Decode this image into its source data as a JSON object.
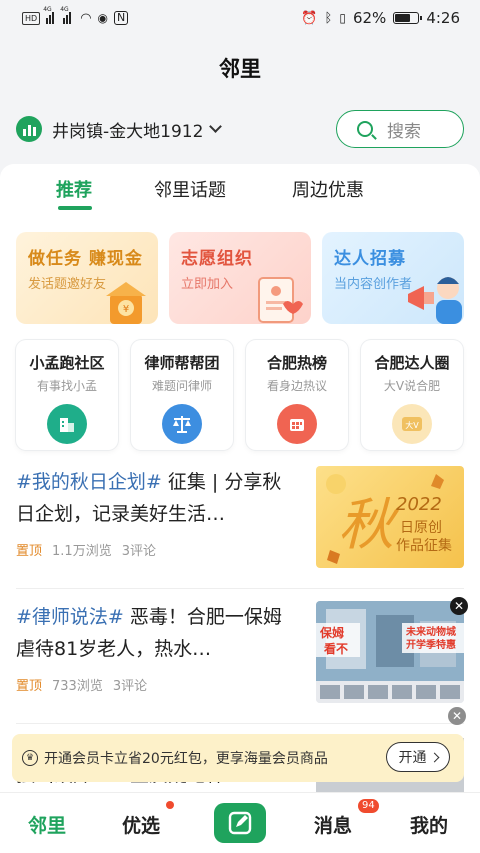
{
  "status_bar": {
    "battery": "62%",
    "time": "4:26",
    "network_left": "4G",
    "network_right": "4G"
  },
  "app_title": "邻里",
  "location": {
    "text": "井岗镇-金大地1912"
  },
  "search": {
    "label": "搜索"
  },
  "tabs": [
    {
      "label": "推荐",
      "active": true
    },
    {
      "label": "邻里话题",
      "active": false
    },
    {
      "label": "周边优惠",
      "active": false
    }
  ],
  "banners": [
    {
      "title": "做任务 赚现金",
      "subtitle": "发话题邀好友"
    },
    {
      "title": "志愿组织",
      "subtitle": "立即加入"
    },
    {
      "title": "达人招募",
      "subtitle": "当内容创作者"
    }
  ],
  "cards": [
    {
      "title": "小孟跑社区",
      "subtitle": "有事找小孟",
      "icon": "building-icon",
      "color": "#1fae8a"
    },
    {
      "title": "律师帮帮团",
      "subtitle": "难题问律师",
      "icon": "scale-icon",
      "color": "#3d8ee0"
    },
    {
      "title": "合肥热榜",
      "subtitle": "看身边热议",
      "icon": "fire-list-icon",
      "color": "#f06452"
    },
    {
      "title": "合肥达人圈",
      "subtitle": "大V说合肥",
      "icon": "bigv-icon",
      "color": "#f0c060"
    }
  ],
  "feed": [
    {
      "tag": "#我的秋日企划#",
      "text": " 征集 | 分享秋日企划，记录美好生活…",
      "pin": "置顶",
      "views": "1.1万浏览",
      "comments": "3评论",
      "thumb_big": "秋",
      "thumb_year": "2022",
      "thumb_line1": "日原创",
      "thumb_line2": "作品征集"
    },
    {
      "tag": "#律师说法#",
      "text": " 恶毒！合肥一保姆虐待81岁老人，热水…",
      "pin": "置顶",
      "views": "733浏览",
      "comments": "3评论",
      "thumb_caption_1": "保姆",
      "thumb_caption_2": "看不",
      "thumb_caption_3": "未来动物城",
      "thumb_caption_4": "开学季特惠"
    }
  ],
  "promo": {
    "text": "开通会员卡立省20元红包，更享海量会员商品",
    "button": "开通",
    "icon_glyph": "♛"
  },
  "partial_feed_text": "独出故障！业主质疑电梯",
  "bottom_nav": [
    {
      "label": "邻里",
      "active": true
    },
    {
      "label": "优选",
      "dot": true
    },
    {
      "label": "发布",
      "icon": "edit-icon"
    },
    {
      "label": "消息",
      "badge": "94"
    },
    {
      "label": "我的"
    }
  ],
  "colors": {
    "brand_green": "#1fa35d",
    "tag_blue": "#3a70b3",
    "pin_orange": "#e28a2a",
    "promo_bg": "#fdf1c9"
  }
}
